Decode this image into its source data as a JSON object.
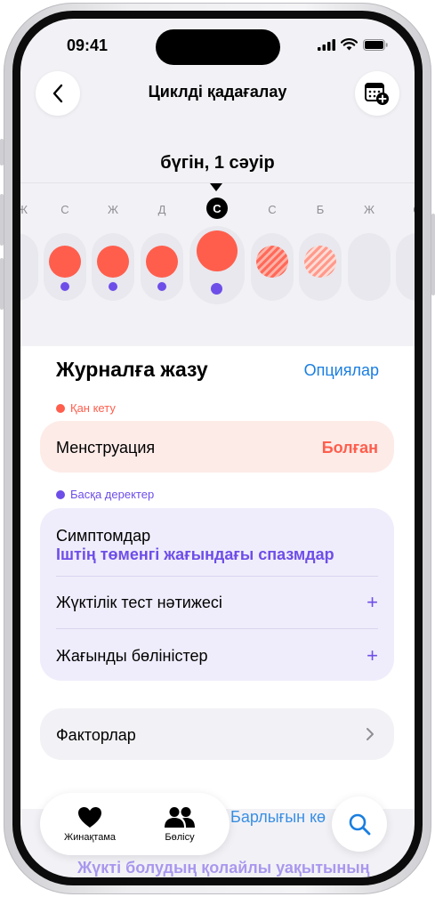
{
  "status": {
    "time": "09:41"
  },
  "nav": {
    "title": "Циклді қадағалау"
  },
  "calendar": {
    "date_label": "бүгін, 1 сәуір",
    "days": [
      {
        "letter": "Ж",
        "period": "none",
        "fertile": false
      },
      {
        "letter": "С",
        "period": "full",
        "fertile": true
      },
      {
        "letter": "Ж",
        "period": "full",
        "fertile": true
      },
      {
        "letter": "Д",
        "period": "full",
        "fertile": true
      },
      {
        "letter": "С",
        "period": "full",
        "fertile": true,
        "today": true
      },
      {
        "letter": "С",
        "period": "predicted",
        "fertile": false
      },
      {
        "letter": "Б",
        "period": "predicted-light",
        "fertile": false
      },
      {
        "letter": "Ж",
        "period": "none",
        "fertile": false
      },
      {
        "letter": "С",
        "period": "none",
        "fertile": false
      }
    ]
  },
  "log": {
    "title": "Журналға жазу",
    "options_label": "Опциялар",
    "bleeding": {
      "tag": "Қан кету",
      "label": "Менструация",
      "value": "Болған"
    },
    "other": {
      "tag": "Басқа деректер",
      "symptoms_label": "Симптомдар",
      "symptoms_value": "Іштің төменгі жағындағы спазмдар",
      "pregnancy_label": "Жүктілік тест нәтижесі",
      "discharge_label": "Жағынды бөліністер",
      "add_symbol": "+"
    },
    "factors_label": "Факторлар"
  },
  "behind": {
    "show_all": "Барлығын кө",
    "fertile_text": "Жүкті болудың қолайлы уақытының"
  },
  "tabbar": {
    "summary_label": "Жинақтама",
    "sharing_label": "Бөлісу"
  },
  "colors": {
    "accent": "#1a7ee0",
    "period": "#ff5e4d",
    "fertile": "#6e4ee8",
    "period_card": "#fdebe8",
    "other_card": "#efedfb"
  }
}
